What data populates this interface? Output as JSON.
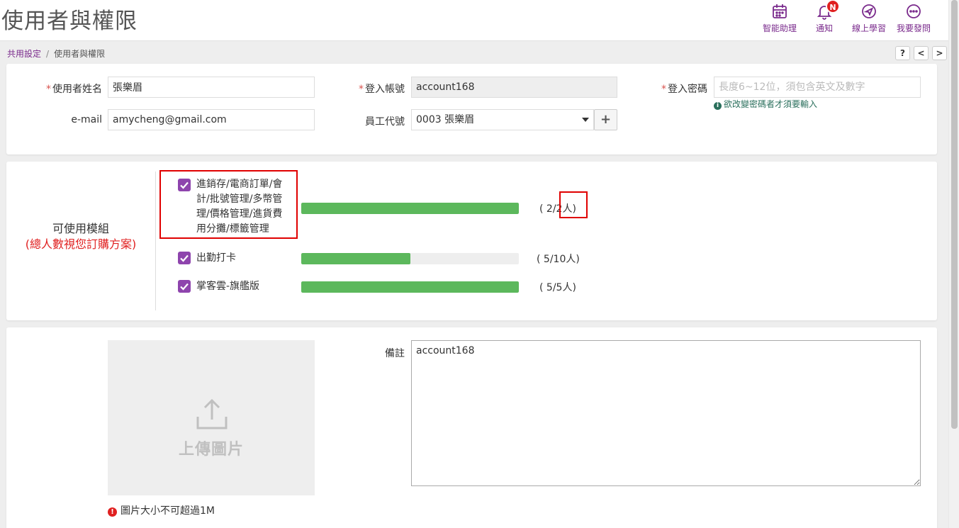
{
  "page": {
    "title": "使用者與權限"
  },
  "header_actions": [
    {
      "label": "智能助理",
      "icon": "calendar-icon"
    },
    {
      "label": "通知",
      "icon": "bell-icon",
      "badge": "N"
    },
    {
      "label": "線上學習",
      "icon": "send-icon"
    },
    {
      "label": "我要發問",
      "icon": "chat-icon"
    }
  ],
  "breadcrumb": {
    "parent": "共用設定",
    "separator": "/",
    "current": "使用者與權限"
  },
  "nav": {
    "help": "?",
    "prev": "<",
    "next": ">"
  },
  "form": {
    "user_name_label": "使用者姓名",
    "user_name_value": "張樂眉",
    "login_account_label": "登入帳號",
    "login_account_value": "account168",
    "password_label": "登入密碼",
    "password_placeholder": "長度6~12位，須包含英文及數字",
    "password_hint": "欲改變密碼者才須要輸入",
    "email_label": "e-mail",
    "email_value": "amycheng@gmail.com",
    "employee_label": "員工代號",
    "employee_value": "0003 張樂眉",
    "add_label": "+",
    "required_mark": "*"
  },
  "modules": {
    "title": "可使用模組",
    "subtitle": "(總人數視您訂購方案)",
    "items": [
      {
        "name": "進銷存/電商訂單/會計/批號管理/多幣管理/價格管理/進貨費用分攤/標籤管理",
        "used": 2,
        "total": 2,
        "count_text": "( 2/2人)",
        "checked": true
      },
      {
        "name": "出勤打卡",
        "used": 5,
        "total": 10,
        "count_text": "( 5/10人)",
        "checked": true
      },
      {
        "name": "掌客雲-旗艦版",
        "used": 5,
        "total": 5,
        "count_text": "( 5/5人)",
        "checked": true
      }
    ]
  },
  "upload": {
    "label": "上傳圖片",
    "warning": "圖片大小不可超過1M"
  },
  "remarks": {
    "label": "備註",
    "value": "account168"
  },
  "colors": {
    "accent": "#7a2a8c",
    "checkbox": "#8e44ad",
    "progress": "#5cb85c",
    "danger": "#e02020",
    "hint": "#2a6f5c"
  }
}
